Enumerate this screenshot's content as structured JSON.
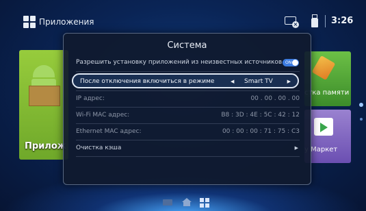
{
  "topbar": {
    "apps_label": "Приложения",
    "clock": "3:26",
    "icons": [
      "apps-grid-icon",
      "network-disconnected-icon",
      "usb-icon"
    ]
  },
  "tiles": {
    "apps_label": "Прилож",
    "memory_label": "стка памяти",
    "play_label": "y Маркет"
  },
  "dialog": {
    "title": "Система",
    "rows": [
      {
        "label": "Разрешить установку приложений из неизвестных источников",
        "toggle_text": "ON"
      },
      {
        "label": "После отключения включиться в режиме",
        "value": "Smart TV",
        "arrow_left": "◀",
        "arrow_right": "▶"
      },
      {
        "label": "IP адрес:",
        "value": "00 . 00 . 00 . 00"
      },
      {
        "label": "Wi-Fi MAC адрес:",
        "value": "B8 : 3D : 4E : 5C : 42 : 12"
      },
      {
        "label": "Ethernet MAC адрес:",
        "value": "00 : 00 : 00 : 71 : 75 : C3"
      },
      {
        "label": "Очистка кэша",
        "chevron": "▶"
      }
    ]
  },
  "bottom_nav": [
    "tv-icon",
    "home-icon",
    "apps-grid-icon"
  ],
  "colors": {
    "background": "#0a2455",
    "dialog_bg": "#101a2e",
    "toggle_on": "#3c7be0"
  }
}
